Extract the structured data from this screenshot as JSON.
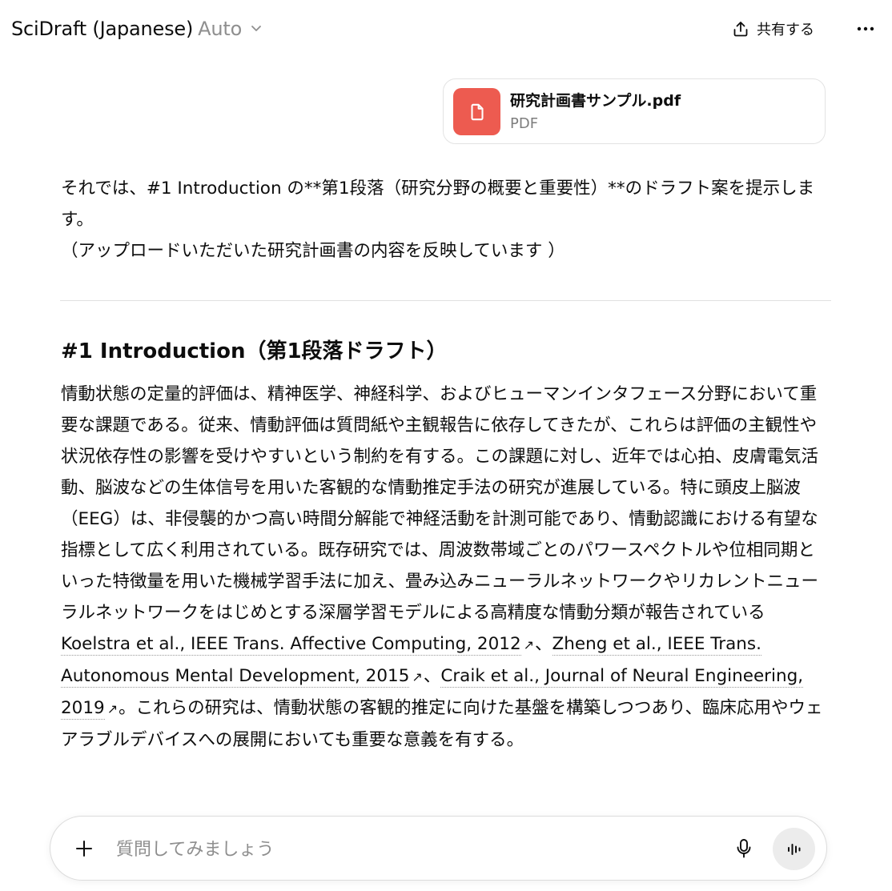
{
  "header": {
    "app_title": "SciDraft (Japanese)",
    "model_mode": "Auto",
    "share_label": "共有する",
    "icons": {
      "share": "share-upload-icon",
      "more": "more-horizontal-icon",
      "chevron": "chevron-down-icon"
    }
  },
  "attachment": {
    "file_name": "研究計画書サンプル.pdf",
    "file_type": "PDF",
    "icon": "document-icon",
    "icon_color": "#ed5b50"
  },
  "message": {
    "intro_line1": "それでは、#1 Introduction の**第1段落（研究分野の概要と重要性）**のドラフト案を提示します。",
    "intro_line2": "（アップロードいただいた研究計画書の内容を反映しています ）",
    "section_heading": "#1 Introduction（第1段落ドラフト）",
    "body_text": "情動状態の定量的評価は、精神医学、神経科学、およびヒューマンインタフェース分野において重要な課題である。従来、情動評価は質問紙や主観報告に依存してきたが、これらは評価の主観性や状況依存性の影響を受けやすいという制約を有する。この課題に対し、近年では心拍、皮膚電気活動、脳波などの生体信号を用いた客観的な情動推定手法の研究が進展している。特に頭皮上脳波（EEG）は、非侵襲的かつ高い時間分解能で神経活動を計測可能であり、情動認識における有望な指標として広く利用されている。既存研究では、周波数帯域ごとのパワースペクトルや位相同期といった特徴量を用いた機械学習手法に加え、畳み込みニューラルネットワークやリカレントニューラルネットワークをはじめとする深層学習モデルによる高精度な情動分類が報告されている",
    "citations": [
      {
        "label": "Koelstra et al., IEEE Trans. Affective Computing, 2012"
      },
      {
        "label": "Zheng et al., IEEE Trans. Autonomous Mental Development, 2015"
      },
      {
        "label": "Craik et al., Journal of Neural Engineering, 2019"
      }
    ],
    "citation_sep": "、",
    "citation_arrow": "↗",
    "body_tail": "。これらの研究は、情動状態の客観的推定に向けた基盤を構築しつつあり、臨床応用やウェアラブルデバイスへの展開においても重要な意義を有する。"
  },
  "composer": {
    "placeholder": "質問してみましょう",
    "icons": {
      "add": "plus-icon",
      "mic": "microphone-icon",
      "voice": "voice-waveform-icon"
    }
  }
}
